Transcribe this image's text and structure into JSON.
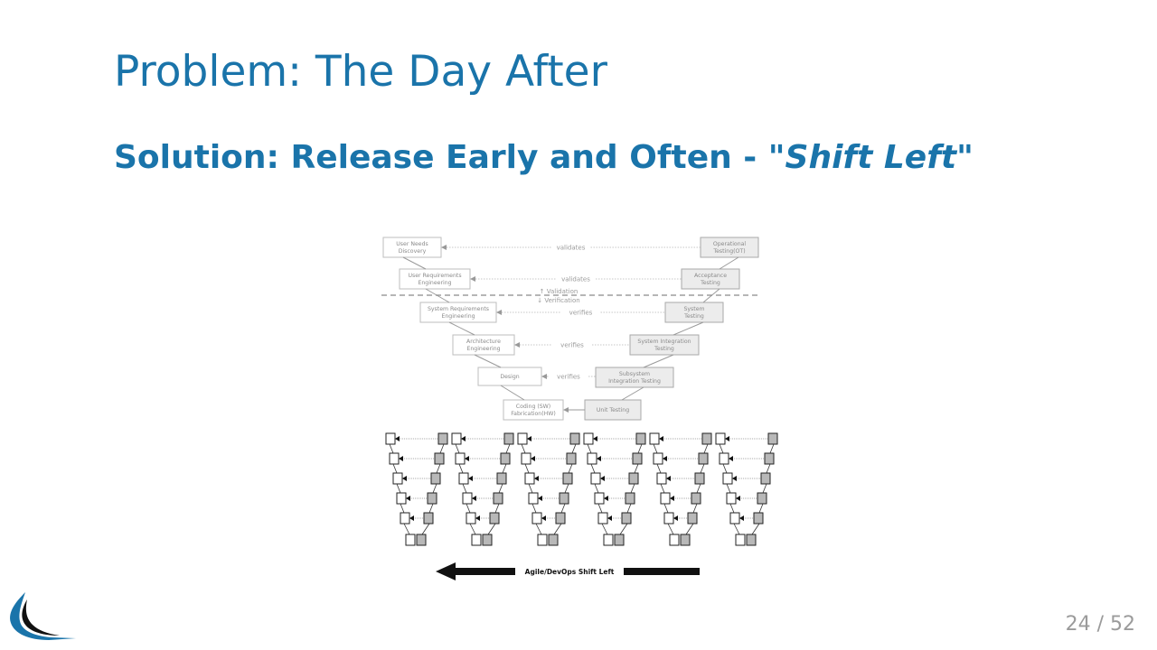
{
  "slide": {
    "title": "Problem: The Day After",
    "subtitle_prefix": "Solution: Release Early and Often - \"",
    "subtitle_emph": "Shift Left",
    "subtitle_suffix": "\"",
    "page_number": "24 / 52"
  },
  "figure": {
    "left_boxes": [
      [
        "User Needs",
        "Discovery"
      ],
      [
        "User Requirements",
        "Engineering"
      ],
      [
        "System Requirements",
        "Engineering"
      ],
      [
        "Architecture",
        "Engineering"
      ],
      [
        "Design"
      ],
      [
        "Coding (SW)",
        "Fabrication(HW)"
      ]
    ],
    "right_boxes": [
      [
        "Operational",
        "Testing(OT)"
      ],
      [
        "Acceptance",
        "Testing"
      ],
      [
        "System",
        "Testing"
      ],
      [
        "System Integration",
        "Testing"
      ],
      [
        "Subsystem",
        "Integration Testing"
      ],
      [
        "Unit Testing"
      ]
    ],
    "links": [
      "validates",
      "validates",
      "verifies",
      "verifies",
      "verifies"
    ],
    "validation_label": "Validation",
    "verification_label": "Verification",
    "arrow_label": "Agile/DevOps Shift Left",
    "mini_v_count": 6
  }
}
